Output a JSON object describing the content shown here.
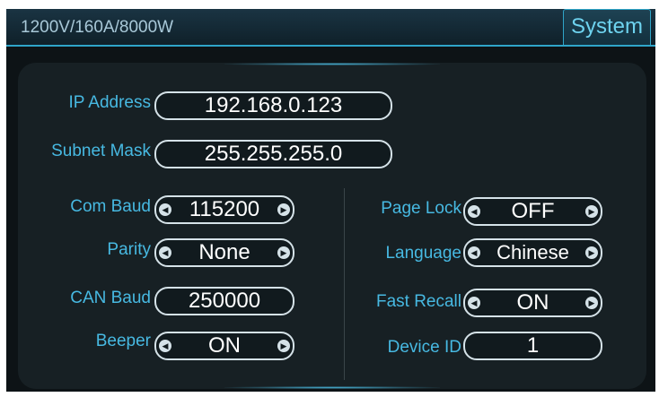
{
  "header": {
    "device_spec": "1200V/160A/8000W",
    "active_tab": "System"
  },
  "settings": {
    "ip_address": {
      "label": "IP Address",
      "value": "192.168.0.123"
    },
    "subnet_mask": {
      "label": "Subnet Mask",
      "value": "255.255.255.0"
    },
    "com_baud": {
      "label": "Com Baud",
      "value": "115200"
    },
    "parity": {
      "label": "Parity",
      "value": "None"
    },
    "can_baud": {
      "label": "CAN Baud",
      "value": "250000"
    },
    "beeper": {
      "label": "Beeper",
      "value": "ON"
    },
    "page_lock": {
      "label": "Page Lock",
      "value": "OFF"
    },
    "language": {
      "label": "Language",
      "value": "Chinese"
    },
    "fast_recall": {
      "label": "Fast Recall",
      "value": "ON"
    },
    "device_id": {
      "label": "Device ID",
      "value": "1"
    }
  },
  "icons": {
    "left": "arrow-left-icon",
    "right": "arrow-right-icon"
  },
  "colors": {
    "label": "#47b9e2",
    "tab_text": "#6ed3ef",
    "header_line": "#2fa5c9",
    "panel_bg": "#172024",
    "field_border": "#d5e2e8"
  }
}
